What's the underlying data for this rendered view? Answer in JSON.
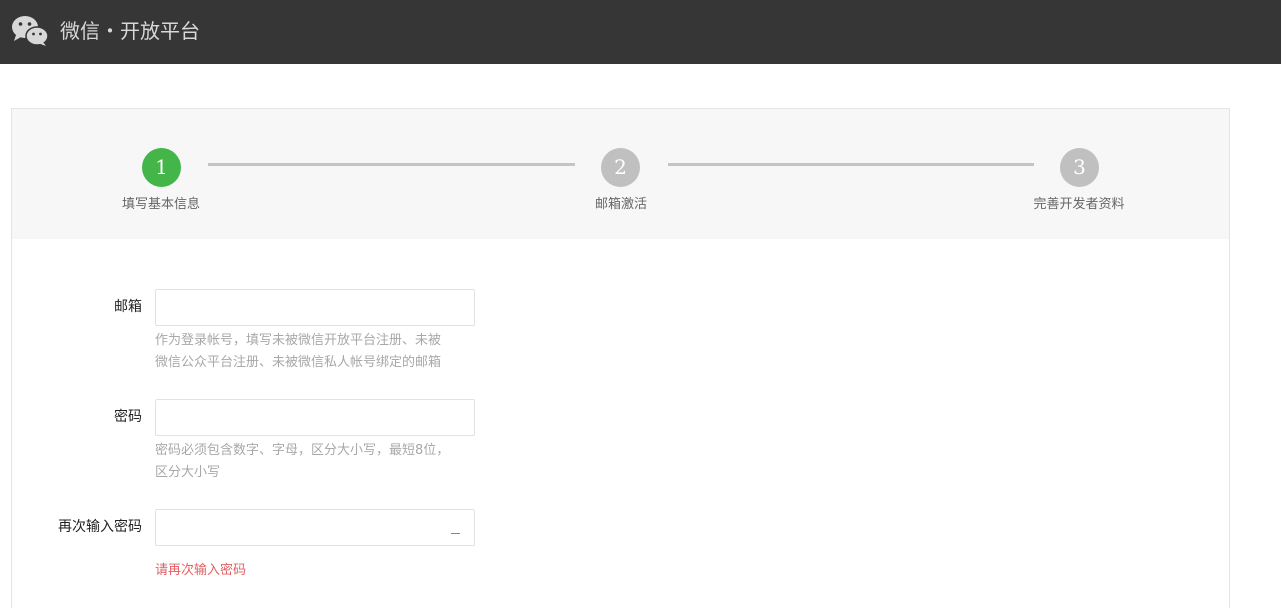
{
  "header": {
    "brand": "微信・开放平台",
    "logo_icon": "wechat-logo-icon",
    "bg_color": "#363636"
  },
  "steps": [
    {
      "number": "1",
      "label": "填写基本信息",
      "state": "active"
    },
    {
      "number": "2",
      "label": "邮箱激活",
      "state": "inactive"
    },
    {
      "number": "3",
      "label": "完善开发者资料",
      "state": "inactive"
    }
  ],
  "colors": {
    "active_step": "#44b549",
    "inactive_step": "#c0c0c0",
    "error_text": "#e15f63"
  },
  "form": {
    "email": {
      "label": "邮箱",
      "value": "",
      "hint_line1": "作为登录帐号，填写未被微信开放平台注册、未被",
      "hint_line2": "微信公众平台注册、未被微信私人帐号绑定的邮箱"
    },
    "password": {
      "label": "密码",
      "value": "",
      "hint_line1": "密码必须包含数字、字母，区分大小写，最短8位，",
      "hint_line2": "区分大小写"
    },
    "confirm_password": {
      "label": "再次输入密码",
      "value": "",
      "error": "请再次输入密码"
    }
  }
}
